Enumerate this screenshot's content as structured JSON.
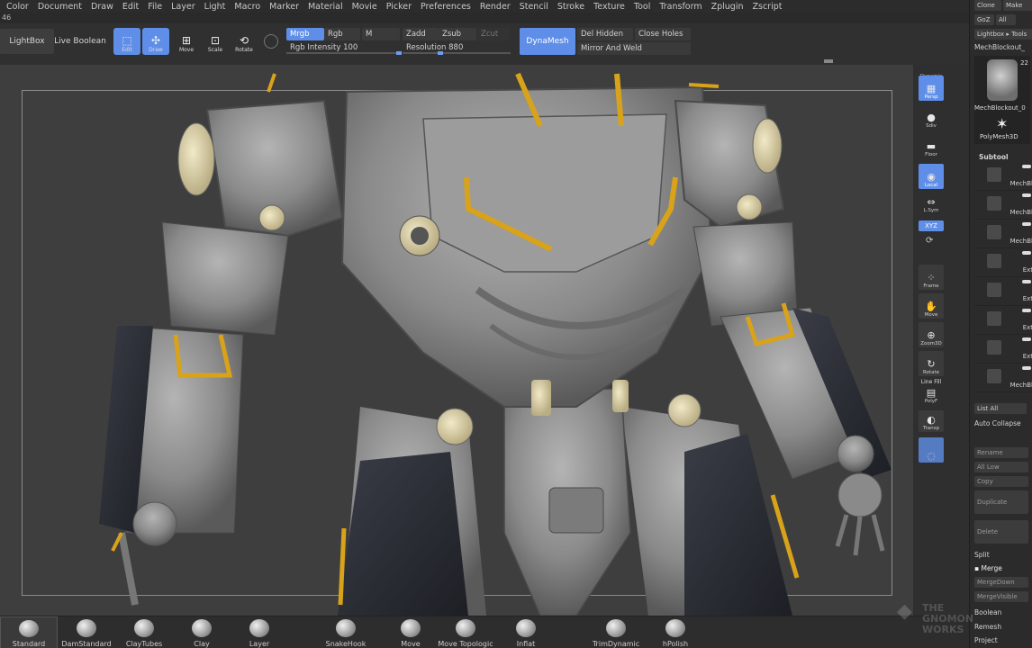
{
  "menu": [
    "Color",
    "Document",
    "Draw",
    "Edit",
    "File",
    "Layer",
    "Light",
    "Macro",
    "Marker",
    "Material",
    "Movie",
    "Picker",
    "Preferences",
    "Render",
    "Stencil",
    "Stroke",
    "Texture",
    "Tool",
    "Transform",
    "Zplugin",
    "Zscript"
  ],
  "counter": "46",
  "shelf": {
    "lightbox": "LightBox",
    "live_boolean": "Live Boolean",
    "edit": "Edit",
    "draw": "Draw",
    "move": "Move",
    "scale": "Scale",
    "rotate": "Rotate",
    "mrgb": "Mrgb",
    "rgb": "Rgb",
    "m": "M",
    "zadd": "Zadd",
    "zsub": "Zsub",
    "zcut": "Zcut",
    "rgb_intensity_label": "Rgb Intensity",
    "rgb_intensity_value": "100",
    "rgb_intensity_fraction": 1.0,
    "resolution_label": "Resolution",
    "resolution_value": "880",
    "resolution_fraction": 0.35,
    "dynamesh": "DynaMesh",
    "del_hidden": "Del Hidden",
    "close_holes": "Close Holes",
    "mirror_weld": "Mirror And Weld"
  },
  "right_shelf": {
    "dynamic_label": "Dynamic",
    "persp": "Persp",
    "sdiv": "Sdiv",
    "floor": "Floor",
    "local": "Local",
    "lsym": "L.Sym",
    "xyz": "XYZ",
    "frame": "Frame",
    "move": "Move",
    "zoom3d": "Zoom3D",
    "rotate": "Rotate",
    "linefill_label": "Line Fill",
    "polyf": "PolyF",
    "transp": "Transp"
  },
  "right_panel": {
    "clone": "Clone",
    "make": "Make",
    "goz": "GoZ",
    "all": "All",
    "lightbox_tools": "Lightbox ▸ Tools",
    "tool_name": "MechBlockout_",
    "tool_count": "22",
    "thumb_label": "MechBlockout_0",
    "polymesh": "PolyMesh3D",
    "subtool_header": "Subtool",
    "subtools": [
      "MechBl",
      "MechBl",
      "MechBl",
      "Ext",
      "Ext",
      "Ext",
      "Ext",
      "MechBl"
    ],
    "list_all": "List All",
    "auto_collapse": "Auto Collapse",
    "rename": "Rename",
    "all_low": "All Low",
    "copy": "Copy",
    "duplicate": "Duplicate",
    "delete": "Delete",
    "split": "Split",
    "merge": "Merge",
    "merge_down": "MergeDown",
    "merge_visible": "MergeVisible",
    "boolean": "Boolean",
    "remesh": "Remesh",
    "project": "Project"
  },
  "brushes": [
    "Standard",
    "DamStandard",
    "ClayTubes",
    "Clay",
    "Layer",
    "SnakeHook",
    "Move",
    "Move Topologic",
    "Inflat",
    "TrimDynamic",
    "hPolish"
  ],
  "selected_brush": "Standard",
  "watermark": [
    "THE",
    "GNOMON",
    "WORKS"
  ],
  "colors": {
    "accent": "#5f8ee8",
    "trim": "#d8a21a",
    "armor": "#8f8f8f",
    "dark_plate": "#2e3038",
    "ivory": "#d9cfa8"
  }
}
